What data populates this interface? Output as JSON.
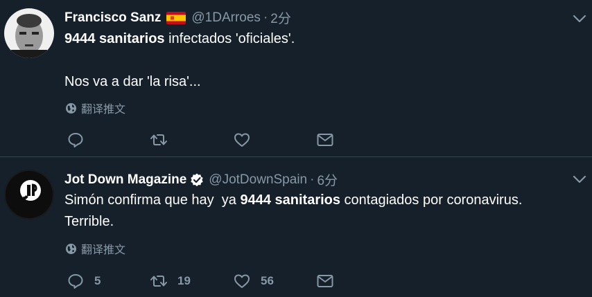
{
  "tweets": [
    {
      "name": "Francisco Sanz",
      "handle": "@1DArroes",
      "separator": "·",
      "time": "2分",
      "text_bold": "9444 sanitarios",
      "text_rest": " infectados 'oficiales'.\n\nNos va a dar 'la risa'...",
      "translate_label": "翻译推文",
      "replies": "",
      "retweets": "",
      "likes": ""
    },
    {
      "name": "Jot Down Magazine",
      "handle": "@JotDownSpain",
      "separator": "·",
      "time": "6分",
      "text_pre": "Simón confirma que hay  ya ",
      "text_bold": "9444 sanitarios",
      "text_post": " contagiados por coronavirus.\nTerrible.",
      "translate_label": "翻译推文",
      "replies": "5",
      "retweets": "19",
      "likes": "56"
    }
  ],
  "colors": {
    "background": "#15202b",
    "secondary_text": "#8899a6",
    "divider": "#38444d",
    "verified": "#ffffff"
  },
  "icons": [
    "flag-spain-icon",
    "verified-badge-icon",
    "chevron-down-icon",
    "globe-icon",
    "reply-icon",
    "retweet-icon",
    "like-icon",
    "message-icon"
  ]
}
